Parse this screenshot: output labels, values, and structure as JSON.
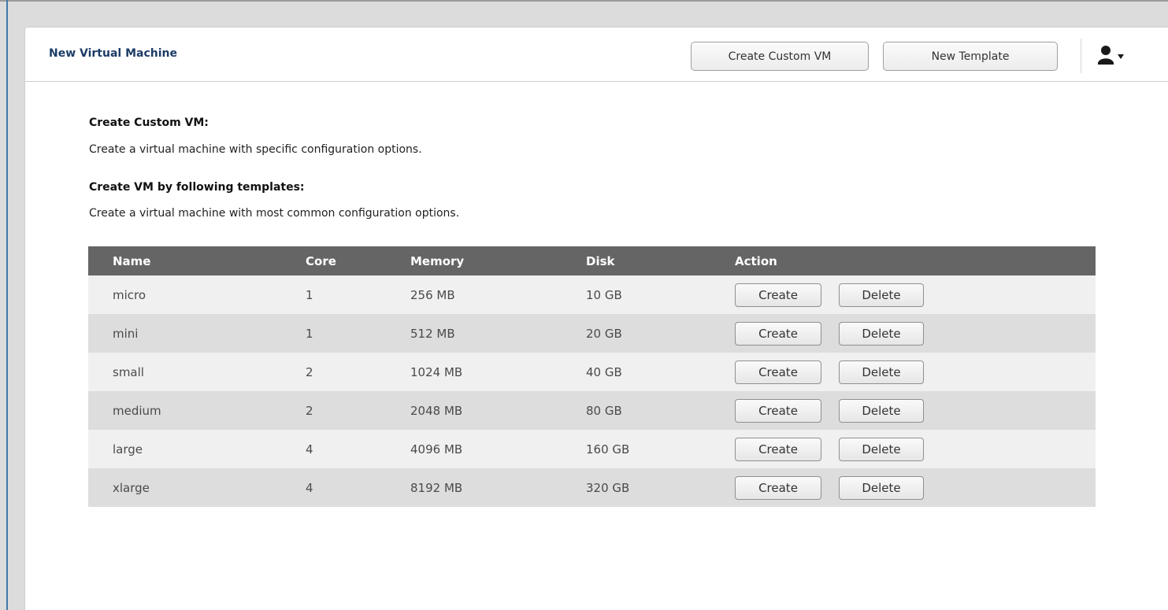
{
  "header": {
    "title": "New Virtual Machine",
    "create_custom_label": "Create Custom VM",
    "new_template_label": "New Template",
    "user_icon": "user-icon",
    "dropdown_icon": "caret-down-icon"
  },
  "description": {
    "custom_heading": "Create Custom VM:",
    "custom_text": "Create a virtual machine with specific configuration options.",
    "template_heading": "Create VM by following templates:",
    "template_text": "Create a virtual machine with most common configuration options."
  },
  "table": {
    "columns": [
      "Name",
      "Core",
      "Memory",
      "Disk",
      "Action"
    ],
    "rows": [
      {
        "name": "micro",
        "core": "1",
        "memory": "256 MB",
        "disk": "10 GB"
      },
      {
        "name": "mini",
        "core": "1",
        "memory": "512 MB",
        "disk": "20 GB"
      },
      {
        "name": "small",
        "core": "2",
        "memory": "1024 MB",
        "disk": "40 GB"
      },
      {
        "name": "medium",
        "core": "2",
        "memory": "2048 MB",
        "disk": "80 GB"
      },
      {
        "name": "large",
        "core": "4",
        "memory": "4096 MB",
        "disk": "160 GB"
      },
      {
        "name": "xlarge",
        "core": "4",
        "memory": "8192 MB",
        "disk": "320 GB"
      }
    ],
    "create_label": "Create",
    "delete_label": "Delete"
  },
  "colors": {
    "title": "#1d3c66",
    "table_header": "#656565",
    "row_light": "#f0f0f0",
    "row_dark": "#dddddd"
  }
}
